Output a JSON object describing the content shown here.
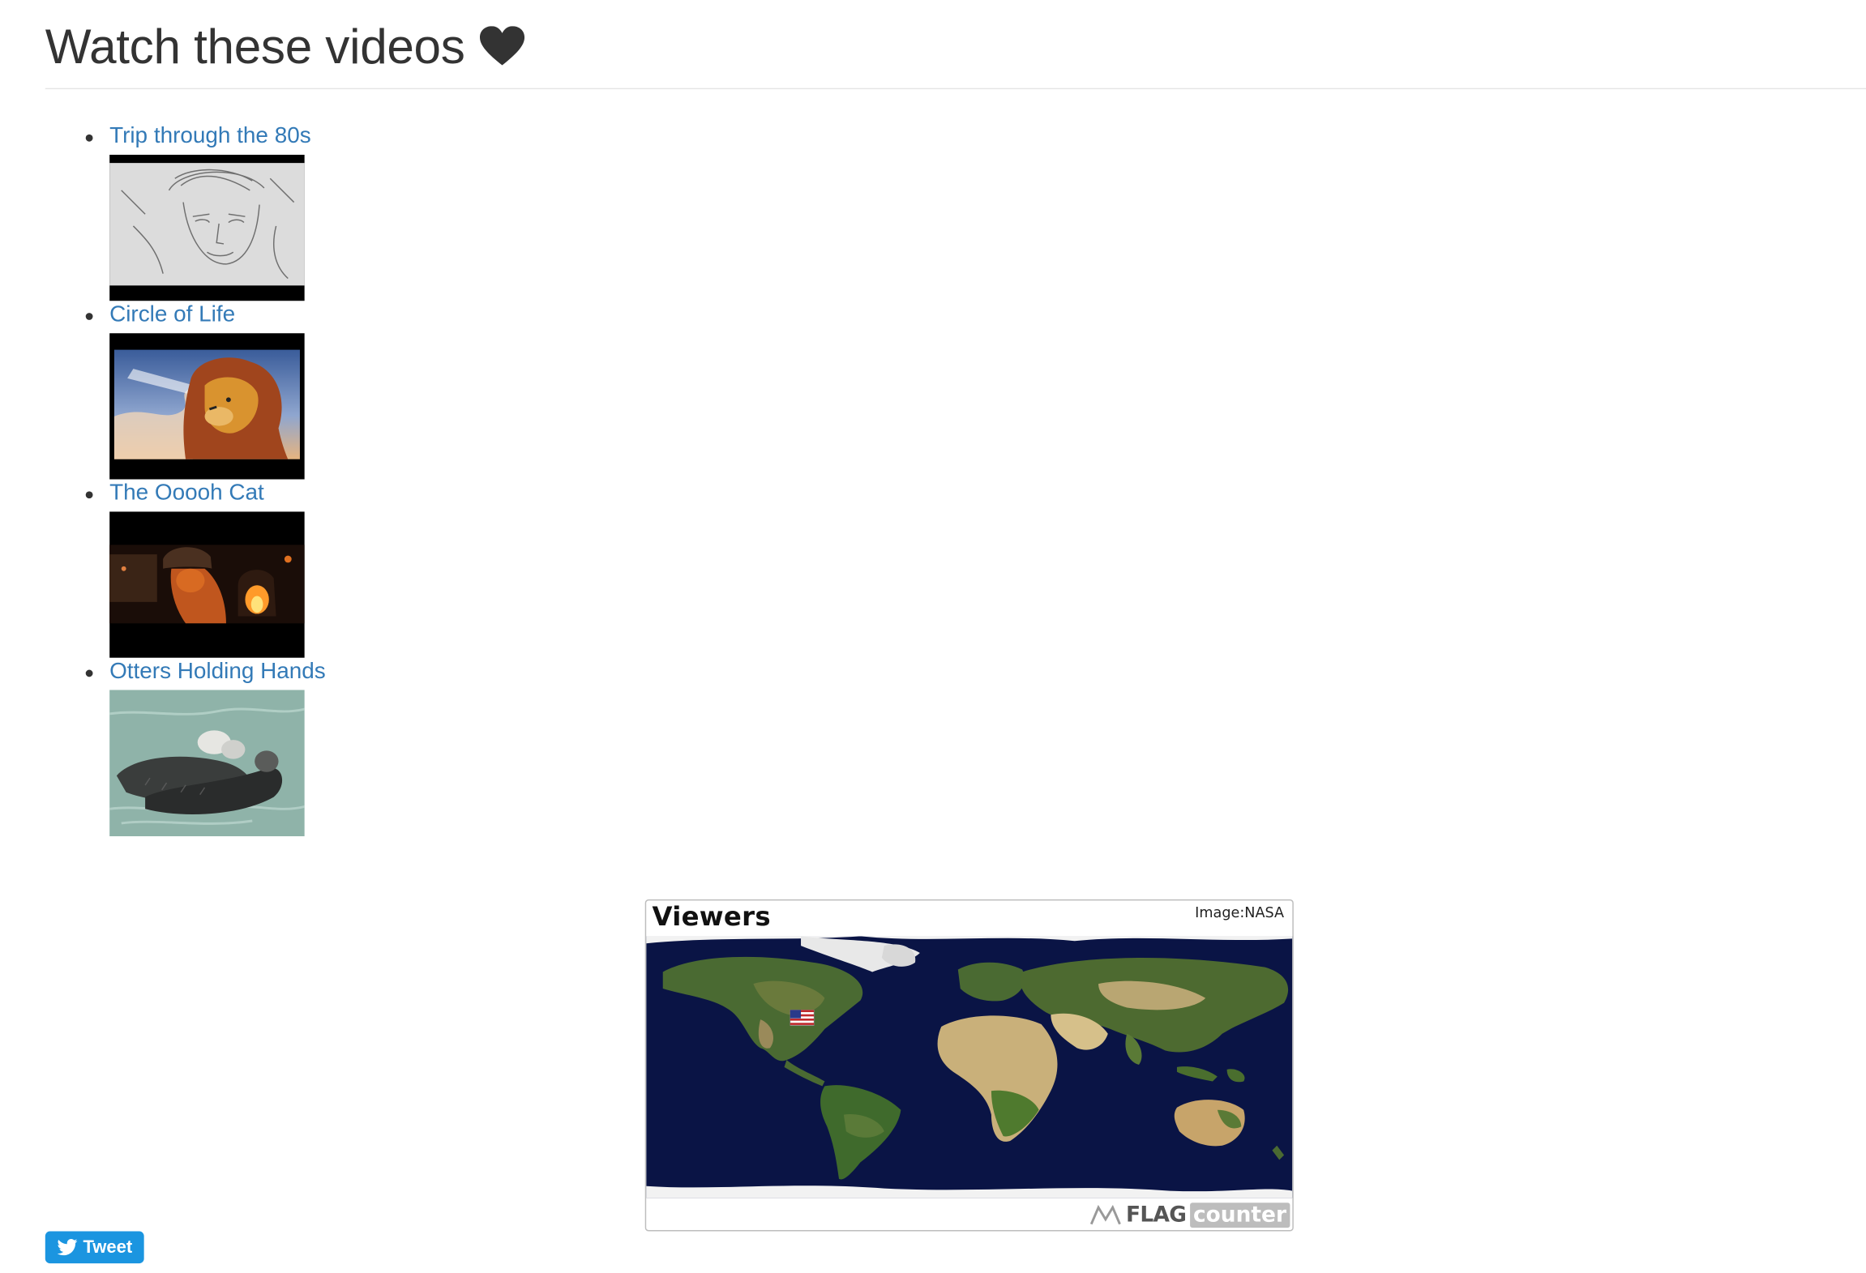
{
  "header": {
    "title": "Watch these videos",
    "heart_icon": "heart-icon"
  },
  "videos": [
    {
      "title": "Trip through the 80s",
      "thumbnail": "pencil-sketch-boy"
    },
    {
      "title": "Circle of Life",
      "thumbnail": "lion-cartoon"
    },
    {
      "title": "The Ooooh Cat",
      "thumbnail": "cat-by-fireplace"
    },
    {
      "title": "Otters Holding Hands",
      "thumbnail": "otters-floating"
    }
  ],
  "flag_counter": {
    "title": "Viewers",
    "credit": "Image:NASA",
    "brand_flag": "FLAG",
    "brand_counter": "counter",
    "map": "world-map",
    "marker_flag": "us-flag-icon"
  },
  "tweet_button": {
    "label": "Tweet",
    "icon": "twitter-bird-icon",
    "color": "#1b95e0"
  },
  "colors": {
    "link": "#337ab7",
    "title": "#333333"
  }
}
